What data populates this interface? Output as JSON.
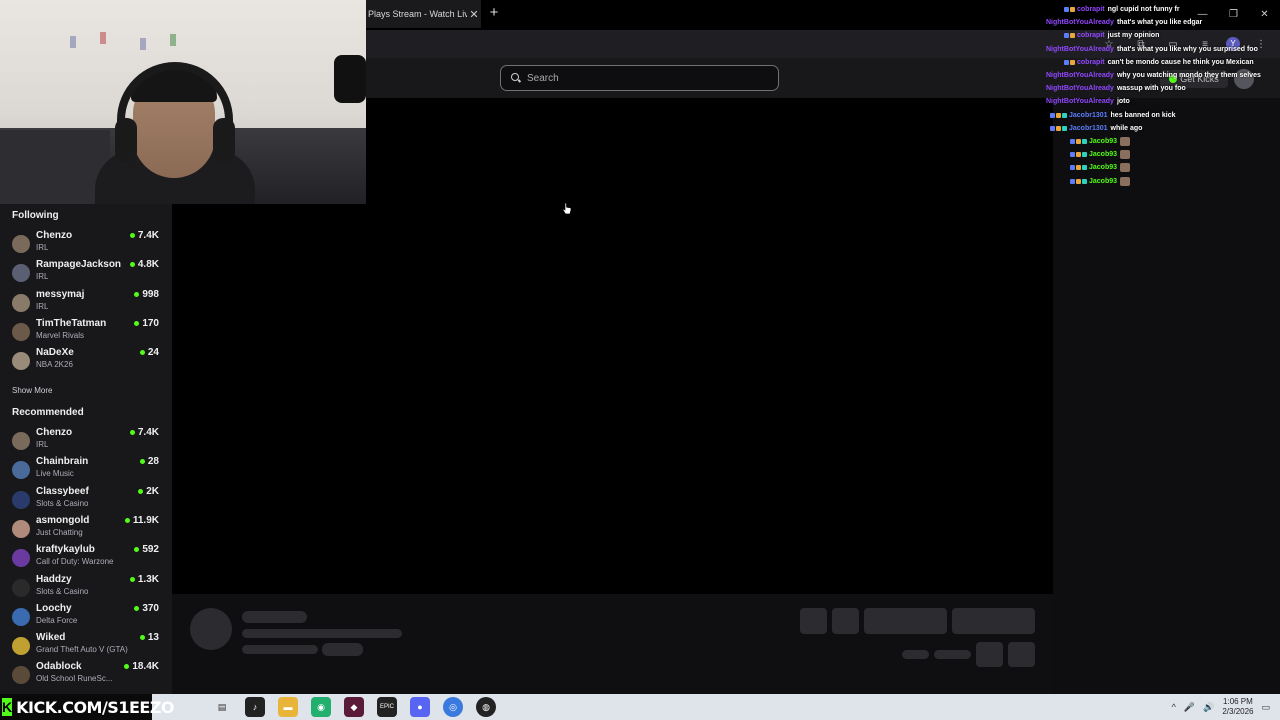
{
  "browser": {
    "tab_title": "Plays Stream - Watch Live",
    "tab_close": "✕",
    "new_tab": "+",
    "window_controls": [
      "—",
      "❐",
      "✕"
    ],
    "toolbar_icons": [
      "☆",
      "⧉",
      "▭",
      "≡",
      "Y",
      "⋮"
    ]
  },
  "header": {
    "search_placeholder": "Search",
    "get_kicks_label": "Get Kicks"
  },
  "sidebar": {
    "following_title": "Following",
    "following": [
      {
        "name": "Chenzo",
        "category": "IRL",
        "viewers": "7.4K",
        "color": "#7a6a5c"
      },
      {
        "name": "RampageJackson",
        "category": "IRL",
        "viewers": "4.8K",
        "color": "#5b5f73"
      },
      {
        "name": "messymaj",
        "category": "IRL",
        "viewers": "998",
        "color": "#8a7a6a"
      },
      {
        "name": "TimTheTatman",
        "category": "Marvel Rivals",
        "viewers": "170",
        "color": "#6b5a4a"
      },
      {
        "name": "NaDeXe",
        "category": "NBA 2K26",
        "viewers": "24",
        "color": "#9a8a7a"
      }
    ],
    "show_more": "Show More",
    "recommended_title": "Recommended",
    "recommended": [
      {
        "name": "Chenzo",
        "category": "IRL",
        "viewers": "7.4K",
        "color": "#7a6a5c"
      },
      {
        "name": "Chainbrain",
        "category": "Live Music",
        "viewers": "28",
        "color": "#4a6a9a"
      },
      {
        "name": "Classybeef",
        "category": "Slots & Casino",
        "viewers": "2K",
        "color": "#2a3a6a"
      },
      {
        "name": "asmongold",
        "category": "Just Chatting",
        "viewers": "11.9K",
        "color": "#b08a7a"
      },
      {
        "name": "kraftykaylub",
        "category": "Call of Duty: Warzone",
        "viewers": "592",
        "color": "#6a3aa0"
      },
      {
        "name": "Haddzy",
        "category": "Slots & Casino",
        "viewers": "1.3K",
        "color": "#2a2a2a"
      },
      {
        "name": "Loochy",
        "category": "Delta Force",
        "viewers": "370",
        "color": "#3a6ab0"
      },
      {
        "name": "Wiked",
        "category": "Grand Theft Auto V (GTA)",
        "viewers": "13",
        "color": "#c0a030"
      },
      {
        "name": "Odablock",
        "category": "Old School RuneSc...",
        "viewers": "18.4K",
        "color": "#5a4a3a"
      }
    ]
  },
  "chat": [
    {
      "user": "cobrapit",
      "color": "#9147ff",
      "text": "ngl cupid not funny fr"
    },
    {
      "user": "NightBotYouAlready",
      "color": "#9147ff",
      "text": "that's what you like edgar"
    },
    {
      "user": "cobrapit",
      "color": "#9147ff",
      "text": "just my opinion"
    },
    {
      "user": "NightBotYouAlready",
      "color": "#9147ff",
      "text": "that's what you like why you surprised foo"
    },
    {
      "user": "cobrapit",
      "color": "#9147ff",
      "text": "can't be mondo cause he think you Mexican"
    },
    {
      "user": "NightBotYouAlready",
      "color": "#9147ff",
      "text": "why you watching mondo they them selves"
    },
    {
      "user": "NightBotYouAlready",
      "color": "#9147ff",
      "text": "wassup with you foo"
    },
    {
      "user": "NightBotYouAlready",
      "color": "#9147ff",
      "text": "joto"
    },
    {
      "user": "Jacobr1301",
      "color": "#5c7cfa",
      "text": "hes banned on kick"
    },
    {
      "user": "Jacobr1301",
      "color": "#5c7cfa",
      "text": "while ago"
    },
    {
      "user": "Jacob93",
      "color": "#53fc18",
      "text": ""
    },
    {
      "user": "Jacob93",
      "color": "#53fc18",
      "text": ""
    },
    {
      "user": "Jacob93",
      "color": "#53fc18",
      "text": ""
    },
    {
      "user": "Jacob93",
      "color": "#53fc18",
      "text": ""
    }
  ],
  "taskbar": {
    "kick_letter": "K",
    "overlay_text": "KICK.COM/S1EEZO",
    "time": "1:06 PM",
    "date": "2/3/2026",
    "tray_icons": [
      "^",
      "🎤",
      "🔊"
    ]
  },
  "colors": {
    "accent": "#53fc18",
    "background": "#0e0e10",
    "sidebar": "#18181b"
  }
}
